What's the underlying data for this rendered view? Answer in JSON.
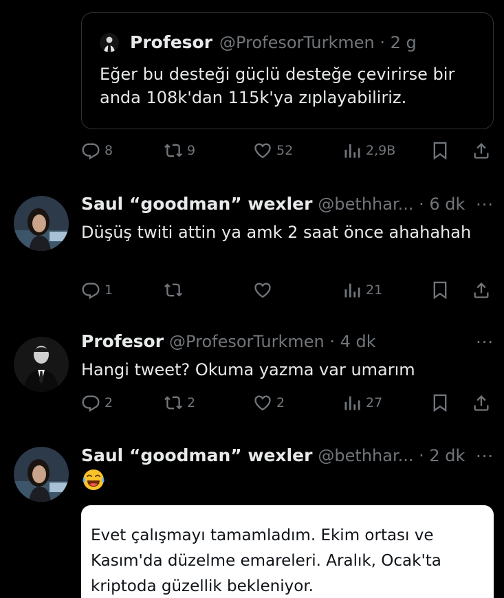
{
  "quote": {
    "name": "Profesor",
    "meta": "@ProfesorTurkmen · 2 g",
    "text": "Eğer bu desteği güçlü desteğe çevirirse bir anda 108k'dan 115k'ya zıplayabiliriz.",
    "actions": {
      "replies": "8",
      "retweets": "9",
      "likes": "52",
      "views": "2,9B"
    }
  },
  "tweets": [
    {
      "name": "Saul “goodman” wexler",
      "meta": "@bethhar... · 6 dk",
      "text": "Düşüş twiti attin ya amk 2 saat önce ahahahah",
      "actions": {
        "replies": "1",
        "retweets": "",
        "likes": "",
        "views": "21"
      }
    },
    {
      "name": "Profesor",
      "meta": "@ProfesorTurkmen · 4 dk",
      "text": "Hangi tweet? Okuma yazma var umarım",
      "actions": {
        "replies": "2",
        "retweets": "2",
        "likes": "2",
        "views": "27"
      }
    },
    {
      "name": "Saul “goodman” wexler",
      "meta": "@bethhar... · 2 dk",
      "emoji": "laughing-tears",
      "image_text": "Evet çalışmayı tamamladım. Ekim ortası ve Kasım'da düzelme emareleri. Aralık, Ocak'ta kriptoda güzellik bekleniyor."
    }
  ],
  "more_label": "···",
  "icons": [
    "reply-icon",
    "retweet-icon",
    "like-icon",
    "views-icon",
    "bookmark-icon",
    "share-icon"
  ],
  "colors": {
    "background": "#000000",
    "text": "#e7e9ea",
    "muted": "#71767b",
    "border": "#2f3336"
  }
}
